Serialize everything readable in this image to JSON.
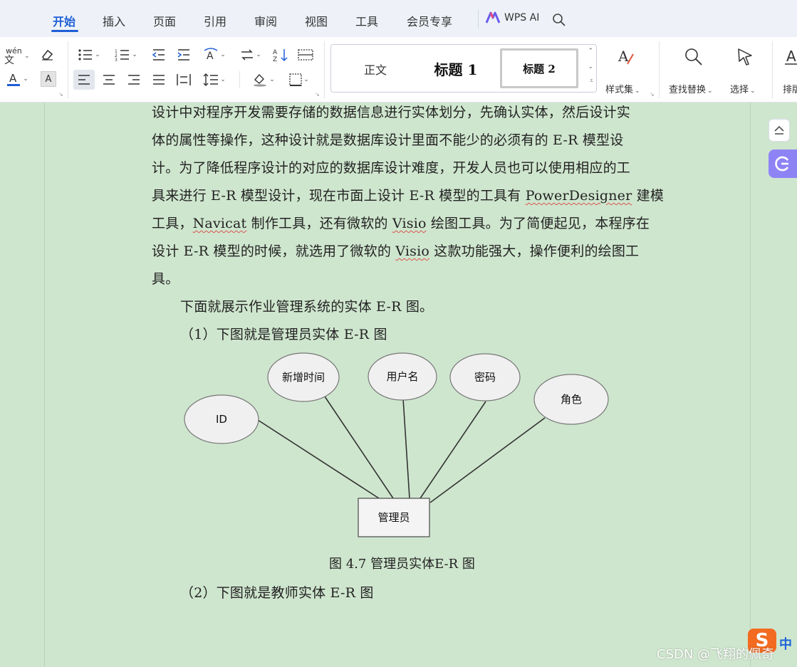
{
  "tabs": [
    "开始",
    "插入",
    "页面",
    "引用",
    "审阅",
    "视图",
    "工具",
    "会员专享"
  ],
  "wps_ai": "WPS AI",
  "ribbon": {
    "style_normal": "正文",
    "style_h1": "标题 1",
    "style_h2": "标题 2",
    "style_set": "样式集",
    "find_replace": "查找替换",
    "select": "选择",
    "layout": "排版",
    "phonetic_glyph": "wén",
    "font_color_accent": "#1f5fd6"
  },
  "document": {
    "lines": [
      "设计中对程序开发需要存储的数据信息进行实体划分，先确认实体，然后设计实",
      "体的属性等操作，这种设计就是数据库设计里面不能少的必须有的 E-R 模型设",
      "计。为了降低程序设计的对应的数据库设计难度，开发人员也可以使用相应的工",
      [
        "具来进行 E-R 模型设计，现在市面上设计 E-R 模型的工具有 ",
        "PowerDesigner",
        " 建模"
      ],
      [
        "工具，",
        "Navicat",
        " 制作工具，还有微软的 ",
        "Visio",
        " 绘图工具。为了简便起见，本程序在"
      ],
      [
        "设计 E-R 模型的时候，就选用了微软的 ",
        "Visio",
        " 这款功能强大，操作便利的绘图工"
      ],
      "具。",
      "下面就展示作业管理系统的实体 E-R 图。",
      "（1）下图就是管理员实体 E-R 图"
    ],
    "diagram": {
      "entity": "管理员",
      "attributes": [
        "ID",
        "新增时间",
        "用户名",
        "密码",
        "角色"
      ]
    },
    "caption": "图 4.7  管理员实体E-R 图",
    "next_line": "（2）下图就是教师实体 E-R 图"
  },
  "ime": {
    "logo": "S",
    "mode": "中"
  },
  "watermark": "CSDN @飞翔的佩奇"
}
